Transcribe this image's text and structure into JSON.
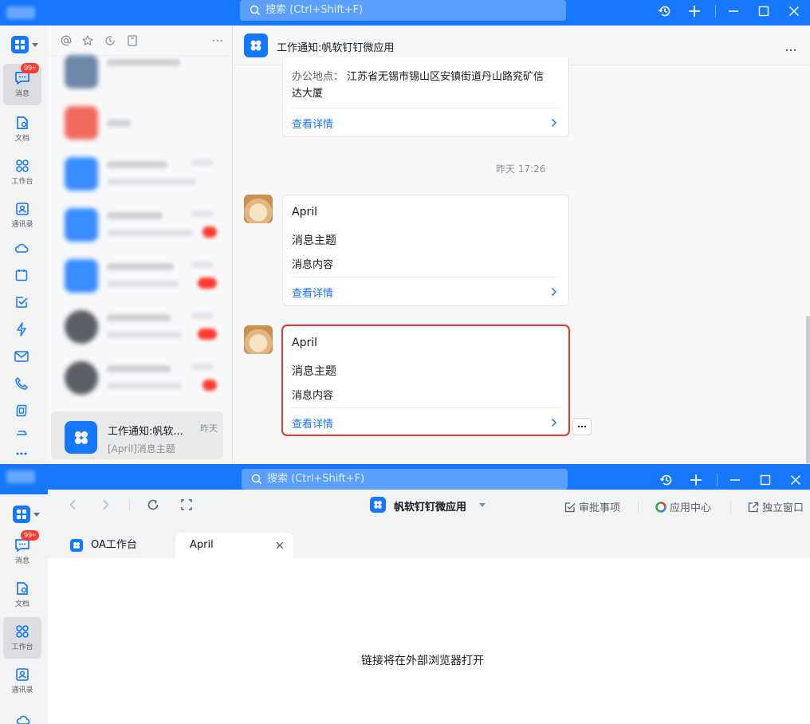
{
  "top": {
    "search_placeholder": "搜索 (Ctrl+Shift+F)",
    "rail": [
      {
        "label": "消息",
        "badge": "99+"
      },
      {
        "label": "文档"
      },
      {
        "label": "工作台"
      },
      {
        "label": "通讯录"
      }
    ],
    "active_conversation": {
      "title": "工作通知:帆软...",
      "time": "昨天",
      "preview": "[April]消息主题"
    },
    "chat_title": "工作通知:帆软钉钉微应用",
    "first_card": {
      "address_label": "办公地点：",
      "address_line1": "江苏省无锡市锡山区安镇街道丹山路兖矿信",
      "address_line2": "达大厦",
      "link": "查看详情"
    },
    "timestamp": "昨天 17:26",
    "cards": [
      {
        "title": "April",
        "subject": "消息主题",
        "content": "消息内容",
        "link": "查看详情"
      },
      {
        "title": "April",
        "subject": "消息主题",
        "content": "消息内容",
        "link": "查看详情"
      }
    ]
  },
  "bottom": {
    "search_placeholder": "搜索 (Ctrl+Shift+F)",
    "rail": [
      {
        "label": "消息",
        "badge": "99+"
      },
      {
        "label": "文档"
      },
      {
        "label": "工作台"
      },
      {
        "label": "通讯录"
      }
    ],
    "app_title": "帆软钉钉微应用",
    "actions": {
      "approval": "审批事项",
      "app_center": "应用中心",
      "window": "独立窗口"
    },
    "tabs": [
      {
        "label": "OA工作台"
      },
      {
        "label": "April"
      }
    ],
    "message": "链接将在外部浏览器打开"
  },
  "colors": {
    "brand": "#1677ff",
    "badge": "#ff3b30",
    "highlight": "#e53935"
  }
}
